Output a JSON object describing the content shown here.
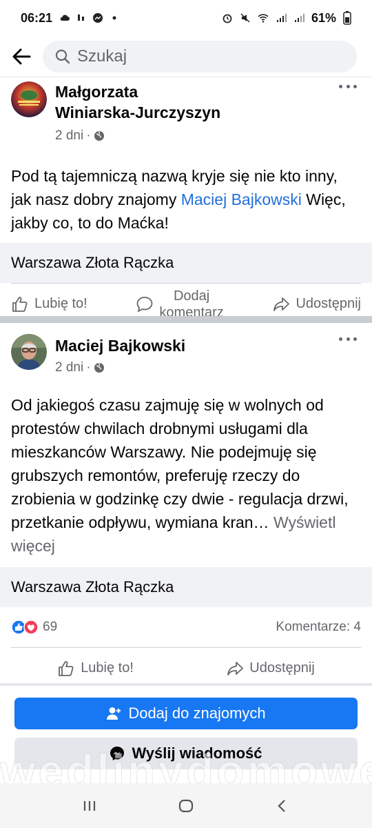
{
  "status_bar": {
    "time": "06:21",
    "battery": "61%"
  },
  "header": {
    "search_placeholder": "Szukaj"
  },
  "posts": [
    {
      "author_line1": "Małgorzata",
      "author_line2": "Winiarska-Jurczyszyn",
      "time": "2 dni",
      "text_before": "Pod tą tajemniczą nazwą kryje się nie kto inny, jak nasz dobry znajomy ",
      "mention": "Maciej Bajkowski",
      "text_after": " Więc, jakby co, to do Maćka!",
      "link_title": "Warszawa Złota Rączka",
      "actions": {
        "like": "Lubię to!",
        "comment_line1": "Dodaj",
        "comment_line2": "komentarz",
        "share": "Udostępnij"
      }
    },
    {
      "author": "Maciej Bajkowski",
      "time": "2 dni",
      "text": "Od jakiegoś czasu zajmuję się w wolnych od protestów chwilach drobnymi usługami dla mieszkanców Warszawy. Nie podejmuję się grubszych remontów, preferuję rzeczy do zrobienia w godzinkę czy dwie - regulacja drzwi, przetkanie odpływu, wymiana kran…",
      "see_more": " Wyświetl więcej",
      "link_title": "Warszawa Złota Rączka",
      "reactions_count": "69",
      "comments_count": "Komentarze: 4",
      "actions": {
        "like": "Lubię to!",
        "share": "Udostępnij"
      }
    }
  ],
  "buttons": {
    "add_friend": "Dodaj do znajomych",
    "send_message": "Wyślij wiadomość"
  },
  "watermark": "wedlinydomowe.p",
  "colors": {
    "primary": "#1877f2",
    "mention": "#216fdb",
    "secondary_text": "#65676b"
  }
}
